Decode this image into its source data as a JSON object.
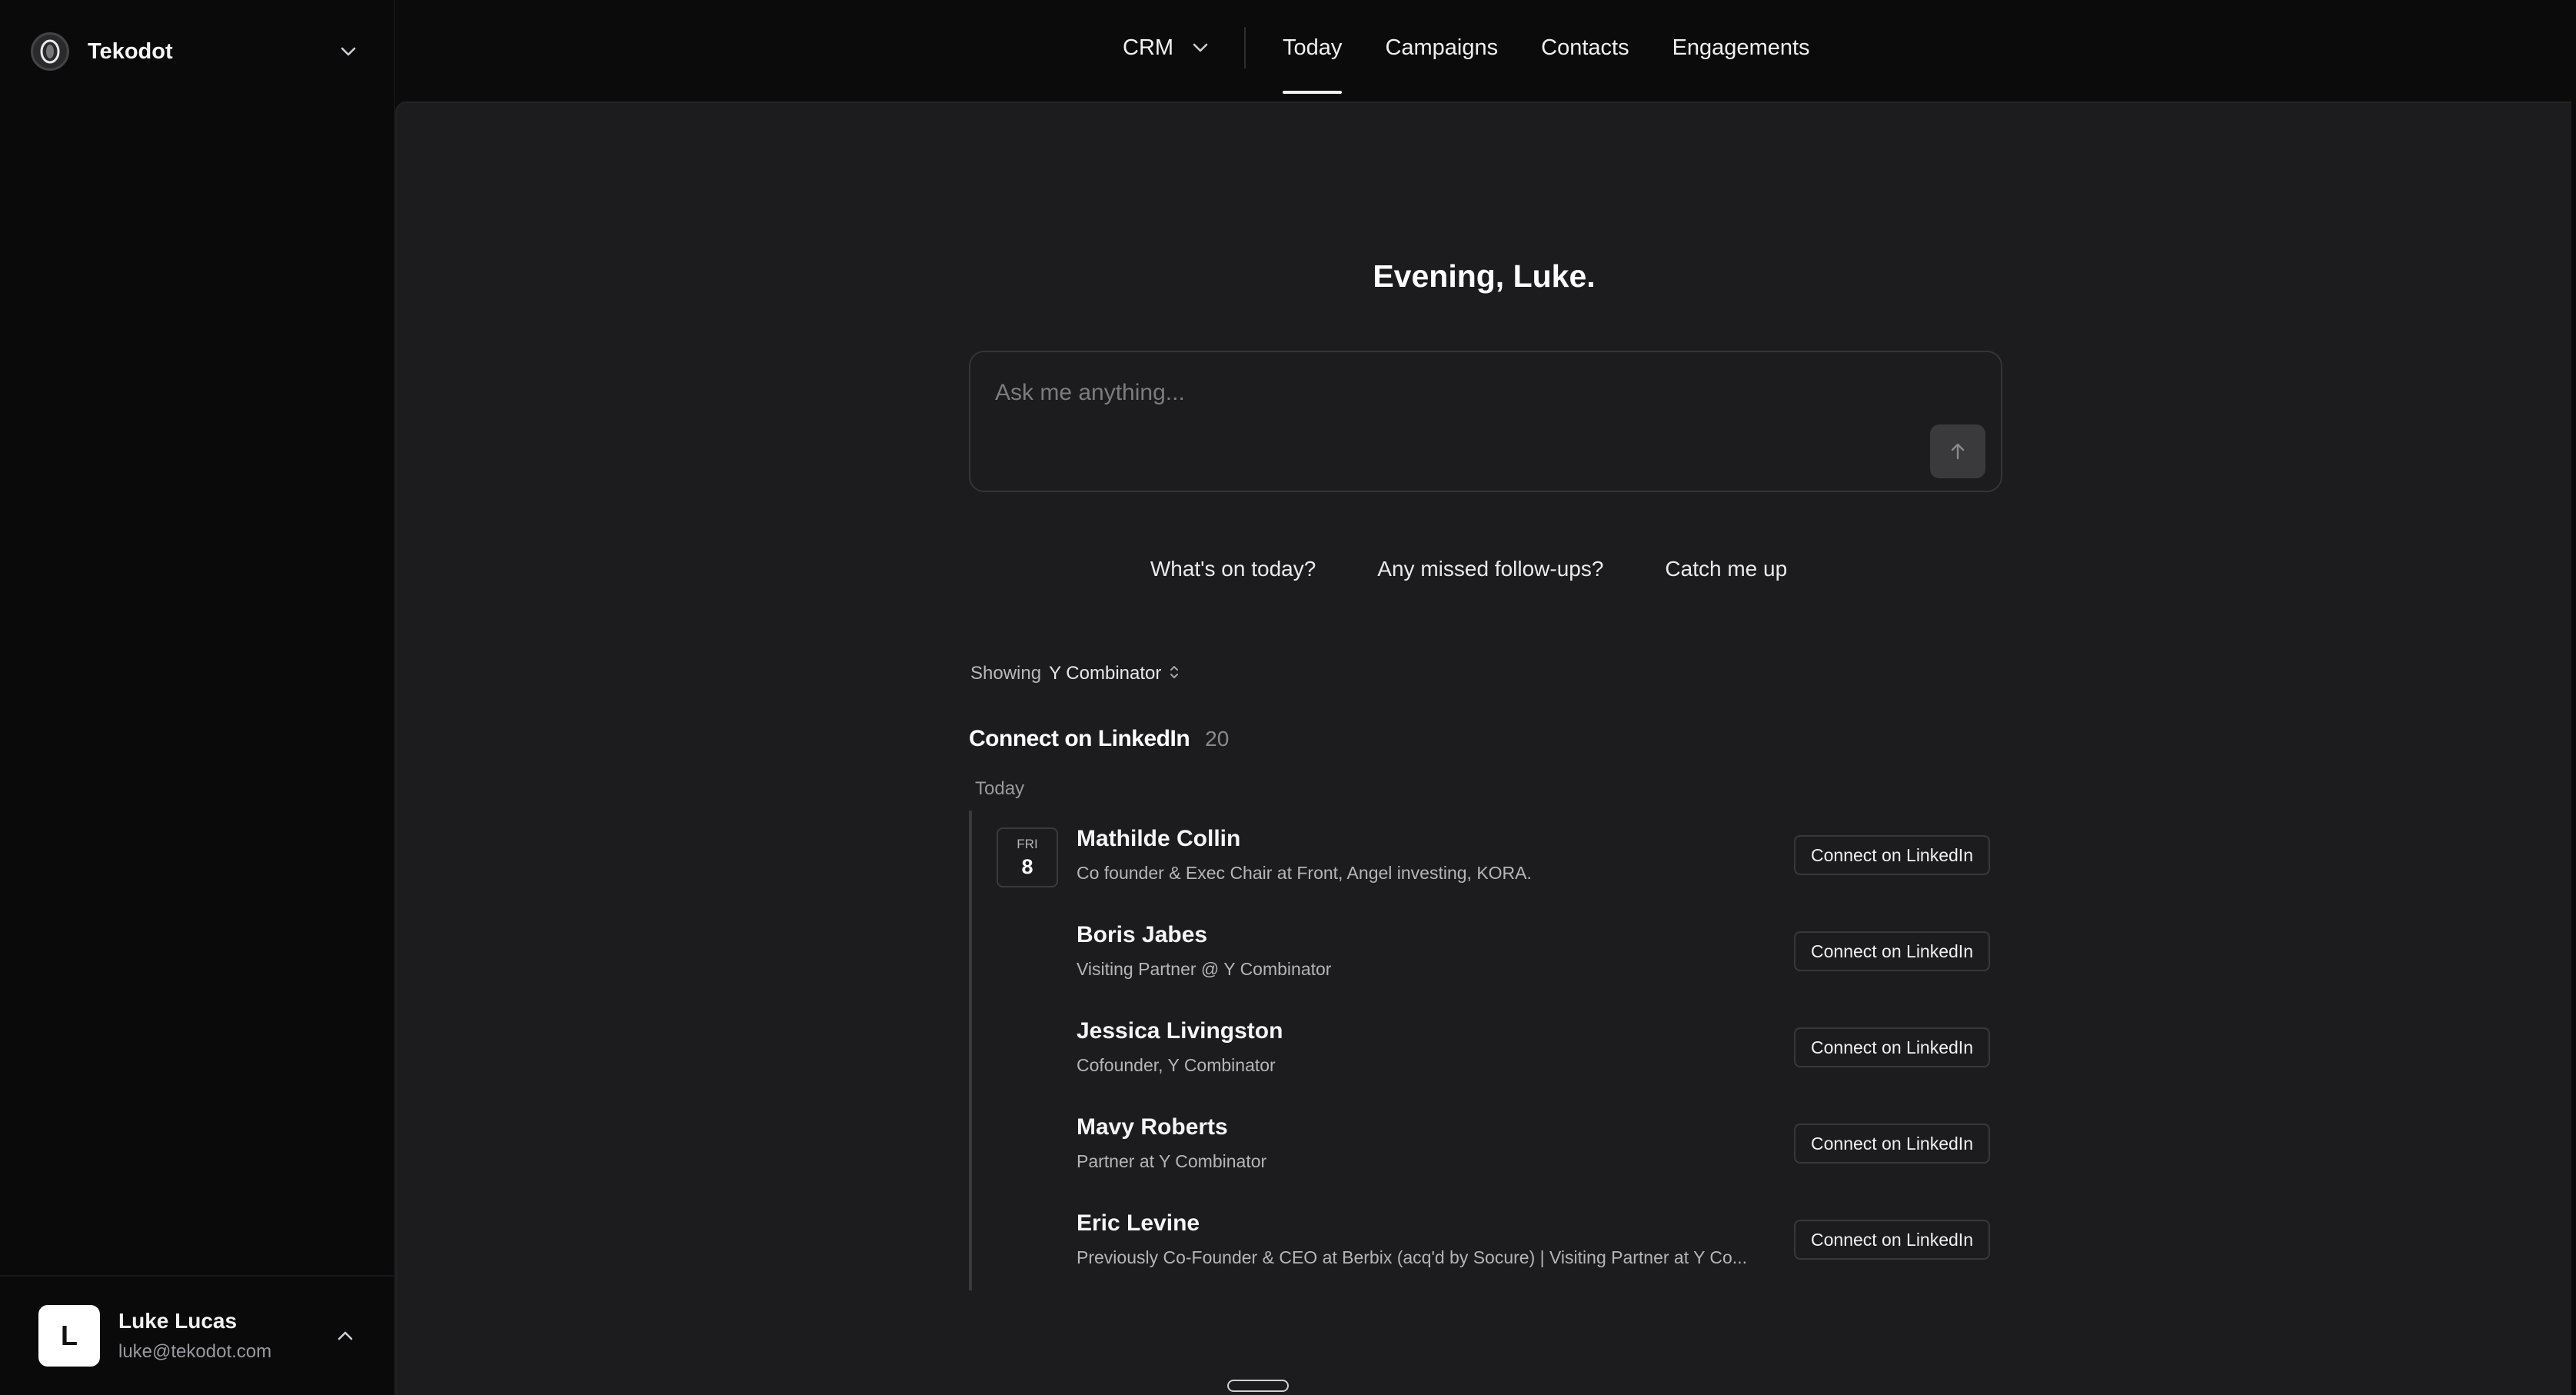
{
  "sidebar": {
    "workspace_name": "Tekodot",
    "user": {
      "initial": "L",
      "name": "Luke Lucas",
      "email": "luke@tekodot.com"
    }
  },
  "topnav": {
    "crm_label": "CRM",
    "tabs": [
      {
        "label": "Today",
        "active": true
      },
      {
        "label": "Campaigns",
        "active": false
      },
      {
        "label": "Contacts",
        "active": false
      },
      {
        "label": "Engagements",
        "active": false
      }
    ]
  },
  "main": {
    "greeting": "Evening, Luke.",
    "ask_placeholder": "Ask me anything...",
    "suggestions": [
      "What's on today?",
      "Any missed follow-ups?",
      "Catch me up"
    ],
    "filter": {
      "label": "Showing",
      "value": "Y Combinator"
    },
    "section": {
      "title": "Connect on LinkedIn",
      "count": "20"
    },
    "day_label": "Today",
    "date_badge": {
      "dow": "FRI",
      "day": "8"
    },
    "rows": [
      {
        "name": "Mathilde Collin",
        "desc": "Co founder & Exec Chair at Front, Angel investing, KORA.",
        "action": "Connect on LinkedIn"
      },
      {
        "name": "Boris Jabes",
        "desc": "Visiting Partner @ Y Combinator",
        "action": "Connect on LinkedIn"
      },
      {
        "name": "Jessica Livingston",
        "desc": "Cofounder, Y Combinator",
        "action": "Connect on LinkedIn"
      },
      {
        "name": "Mavy Roberts",
        "desc": "Partner at Y Combinator",
        "action": "Connect on LinkedIn"
      },
      {
        "name": "Eric Levine",
        "desc": "Previously Co-Founder & CEO at Berbix (acq'd by Socure) | Visiting Partner at Y Co...",
        "action": "Connect on LinkedIn"
      }
    ]
  },
  "icons": {
    "workspace": "tekodot-logo-icon",
    "chevron": "chevron-down-icon",
    "send": "arrow-up-icon",
    "sort": "updown-chevron-icon"
  }
}
